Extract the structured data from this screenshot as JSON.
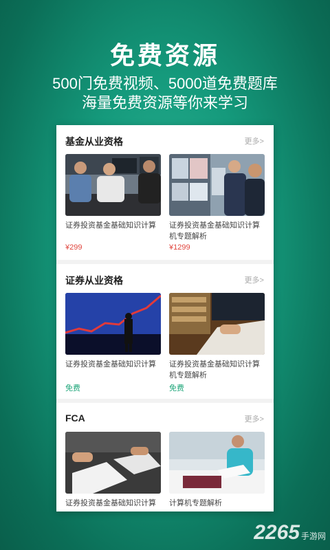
{
  "hero": {
    "title": "免费资源",
    "subtitle_1": "500门免费视频、5000道免费题库",
    "subtitle_2": "海量免费资源等你来学习"
  },
  "sections": [
    {
      "title": "基金从业资格",
      "more": "更多>",
      "cards": [
        {
          "title": "证券投资基金基础知识计算",
          "price": "¥299"
        },
        {
          "title": "证券投资基金基础知识计算机专题解析",
          "price": "¥1299"
        }
      ]
    },
    {
      "title": "证券从业资格",
      "more": "更多>",
      "cards": [
        {
          "title": "证券投资基金基础知识计算",
          "price": "免费"
        },
        {
          "title": "证券投资基金基础知识计算机专题解析",
          "price": "免费"
        }
      ]
    },
    {
      "title": "FCA",
      "more": "更多>",
      "cards": [
        {
          "title": "证券投资基金基础知识计算",
          "price": ""
        },
        {
          "title": "计算机专题解析",
          "price": ""
        }
      ]
    }
  ],
  "watermark": {
    "number": "2265",
    "text": "手游网"
  },
  "colors": {
    "accent_green": "#1fa67a",
    "price_red": "#e0443c",
    "bg_green": "#159a7c"
  }
}
